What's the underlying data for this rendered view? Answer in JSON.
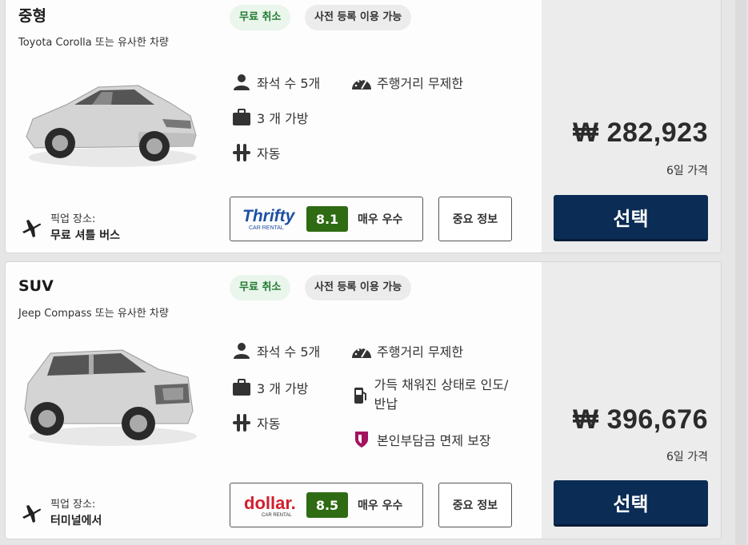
{
  "cards": [
    {
      "category": "중형",
      "subtitle": "Toyota Corolla 또는 유사한 차량",
      "badges": {
        "free_cancel": "무료 취소",
        "precheckin": "사전 등록 이용 가능"
      },
      "features": {
        "seats": "좌석 수 5개",
        "mileage": "주행거리 무제한",
        "bags": "3 개 가방",
        "transmission": "자동"
      },
      "pickup": {
        "label": "픽업 장소:",
        "value": "무료 셔틀 버스"
      },
      "vendor": {
        "name": "Thrifty",
        "tagline": "CAR RENTAL",
        "score": "8.1",
        "score_label": "매우 우수"
      },
      "info_button": "중요 정보",
      "price": "₩ 282,923",
      "price_note": "6일 가격",
      "select_button": "선택",
      "car_color": "#d9d9d9"
    },
    {
      "category": "SUV",
      "subtitle": "Jeep Compass 또는 유사한 차량",
      "badges": {
        "free_cancel": "무료 취소",
        "precheckin": "사전 등록 이용 가능"
      },
      "features": {
        "seats": "좌석 수 5개",
        "mileage": "주행거리 무제한",
        "bags": "3 개 가방",
        "fuel": "가득 채워진 상태로 인도/반납",
        "transmission": "자동",
        "insurance": "본인부담금 면제 보장"
      },
      "pickup": {
        "label": "픽업 장소:",
        "value": "터미널에서"
      },
      "vendor": {
        "name": "dollar.",
        "tagline": "CAR RENTAL",
        "score": "8.5",
        "score_label": "매우 우수"
      },
      "info_button": "중요 정보",
      "price": "₩ 396,676",
      "price_note": "6일 가격",
      "select_button": "선택",
      "car_color": "#d9d9d9"
    }
  ],
  "colors": {
    "select_button": "#0a2c55",
    "score_badge": "#2e6b12",
    "free_cancel_text": "#1f7a2e",
    "thrifty_blue": "#1d4fa3",
    "dollar_red": "#d0202e",
    "insurance_icon": "#a3135f"
  }
}
